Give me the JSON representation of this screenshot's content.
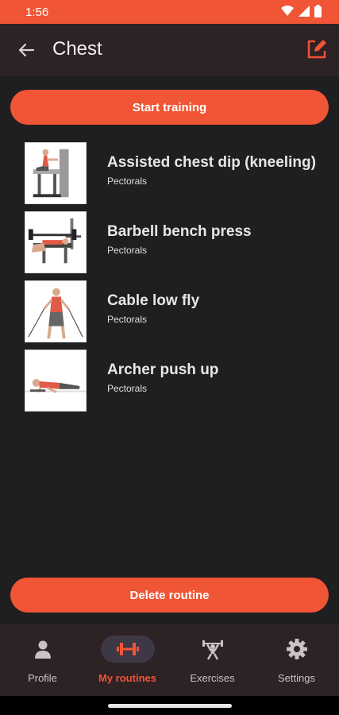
{
  "status_bar": {
    "time": "1:56"
  },
  "header": {
    "title": "Chest",
    "back_icon": "arrow-back-icon",
    "edit_icon": "edit-icon"
  },
  "actions": {
    "start_label": "Start training",
    "delete_label": "Delete routine"
  },
  "exercises": [
    {
      "name": "Assisted chest dip (kneeling)",
      "muscle": "Pectorals"
    },
    {
      "name": "Barbell bench press",
      "muscle": "Pectorals"
    },
    {
      "name": "Cable low fly",
      "muscle": "Pectorals"
    },
    {
      "name": "Archer push up",
      "muscle": "Pectorals"
    }
  ],
  "bottom_nav": {
    "items": [
      {
        "label": "Profile",
        "icon": "person-icon"
      },
      {
        "label": "My routines",
        "icon": "dumbbell-icon",
        "active": true
      },
      {
        "label": "Exercises",
        "icon": "weightlifter-icon"
      },
      {
        "label": "Settings",
        "icon": "gear-icon"
      }
    ]
  },
  "colors": {
    "accent": "#f05535",
    "background": "#1f1e20",
    "bar": "#2d2224"
  }
}
